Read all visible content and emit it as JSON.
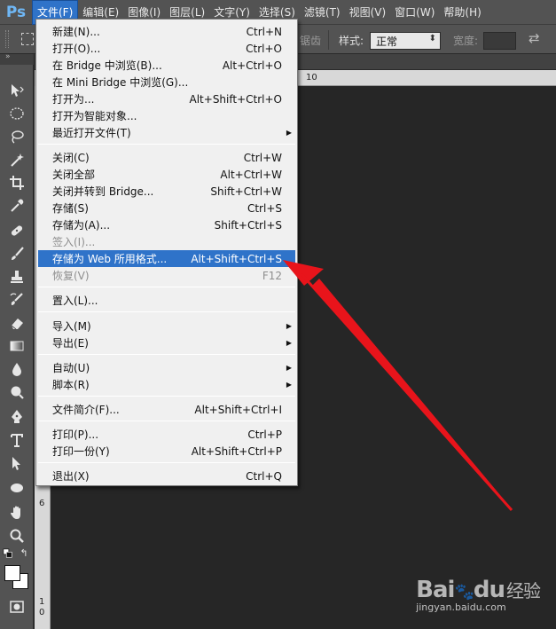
{
  "app": {
    "logo": "Ps",
    "brand_color": "#6fb7f5"
  },
  "menubar": {
    "items": [
      {
        "label": "文件(F)",
        "active": true
      },
      {
        "label": "编辑(E)"
      },
      {
        "label": "图像(I)"
      },
      {
        "label": "图层(L)"
      },
      {
        "label": "文字(Y)"
      },
      {
        "label": "选择(S)"
      },
      {
        "label": "滤镜(T)"
      },
      {
        "label": "视图(V)"
      },
      {
        "label": "窗口(W)"
      },
      {
        "label": "帮助(H)"
      }
    ]
  },
  "options": {
    "partial_label": "锯齿",
    "style_label": "样式:",
    "style_value": "正常",
    "width_label": "宽度:",
    "swap_icon": "swap-arrows-icon"
  },
  "ruler": {
    "top_ticks": [
      "10"
    ],
    "left_ticks": [
      "6",
      "1",
      "0"
    ]
  },
  "file_menu": {
    "items": [
      {
        "label": "新建(N)...",
        "shortcut": "Ctrl+N"
      },
      {
        "label": "打开(O)...",
        "shortcut": "Ctrl+O"
      },
      {
        "label": "在 Bridge 中浏览(B)...",
        "shortcut": "Alt+Ctrl+O"
      },
      {
        "label": "在 Mini Bridge 中浏览(G)...",
        "shortcut": ""
      },
      {
        "label": "打开为...",
        "shortcut": "Alt+Shift+Ctrl+O"
      },
      {
        "label": "打开为智能对象...",
        "shortcut": ""
      },
      {
        "label": "最近打开文件(T)",
        "shortcut": "",
        "submenu": true
      },
      {
        "label": "关闭(C)",
        "shortcut": "Ctrl+W"
      },
      {
        "label": "关闭全部",
        "shortcut": "Alt+Ctrl+W"
      },
      {
        "label": "关闭并转到 Bridge...",
        "shortcut": "Shift+Ctrl+W"
      },
      {
        "label": "存储(S)",
        "shortcut": "Ctrl+S"
      },
      {
        "label": "存储为(A)...",
        "shortcut": "Shift+Ctrl+S"
      },
      {
        "label": "签入(I)...",
        "shortcut": "",
        "disabled": true
      },
      {
        "label": "存储为 Web 所用格式...",
        "shortcut": "Alt+Shift+Ctrl+S",
        "highlight": true
      },
      {
        "label": "恢复(V)",
        "shortcut": "F12",
        "disabled": true
      },
      {
        "label": "置入(L)...",
        "shortcut": ""
      },
      {
        "label": "导入(M)",
        "shortcut": "",
        "submenu": true
      },
      {
        "label": "导出(E)",
        "shortcut": "",
        "submenu": true
      },
      {
        "label": "自动(U)",
        "shortcut": "",
        "submenu": true
      },
      {
        "label": "脚本(R)",
        "shortcut": "",
        "submenu": true
      },
      {
        "label": "文件简介(F)...",
        "shortcut": "Alt+Shift+Ctrl+I"
      },
      {
        "label": "打印(P)...",
        "shortcut": "Ctrl+P"
      },
      {
        "label": "打印一份(Y)",
        "shortcut": "Alt+Shift+Ctrl+P"
      },
      {
        "label": "退出(X)",
        "shortcut": "Ctrl+Q"
      }
    ],
    "highlight_color": "#2f73c9"
  },
  "annotation": {
    "arrow_color": "#e8141b"
  },
  "watermark": {
    "logo_bai": "Bai",
    "logo_du": "du",
    "logo_jingyan": "经验",
    "url": "jingyan.baidu.com"
  }
}
